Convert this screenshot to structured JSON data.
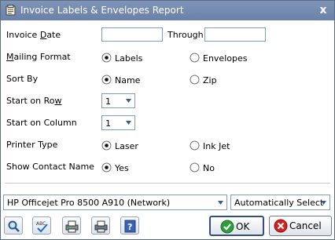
{
  "window": {
    "title": "Invoice Labels & Envelopes Report",
    "close_glyph": "x"
  },
  "invoice_date": {
    "label_pre": "Invoice ",
    "label_access": "D",
    "label_post": "ate",
    "from_value": "",
    "through_label": "Through",
    "through_value": ""
  },
  "mailing_format": {
    "label_access": "M",
    "label_post": "ailing Format",
    "options": [
      "Labels",
      "Envelopes"
    ],
    "selected": "Labels"
  },
  "sort_by": {
    "label": "Sort By",
    "options": [
      "Name",
      "Zip"
    ],
    "selected": "Name"
  },
  "start_row": {
    "label_pre": "Start on Ro",
    "label_access": "w",
    "value": "1"
  },
  "start_column": {
    "label": "Start on Column",
    "value": "1"
  },
  "printer_type": {
    "label": "Printer Type",
    "options": [
      "Laser",
      "Ink Jet"
    ],
    "selected": "Laser"
  },
  "show_contact": {
    "label": "Show Contact Name",
    "options": [
      "Yes",
      "No"
    ],
    "selected": "Yes"
  },
  "printer": {
    "selected": "HP Officejet Pro 8500 A910 (Network)"
  },
  "paper_source": {
    "selected": "Automatically Select"
  },
  "toolbar": {
    "icons": [
      "preview-icon",
      "spell-check-icon",
      "print-preview-icon",
      "print-icon",
      "help-icon"
    ],
    "help_glyph": "?"
  },
  "actions": {
    "ok_label": "OK",
    "cancel_label": "Cancel"
  },
  "colors": {
    "titlebar": "#7088ad",
    "ok_icon": "#2e9e3a",
    "cancel_icon": "#d42020",
    "field_border": "#7a9cc6"
  }
}
